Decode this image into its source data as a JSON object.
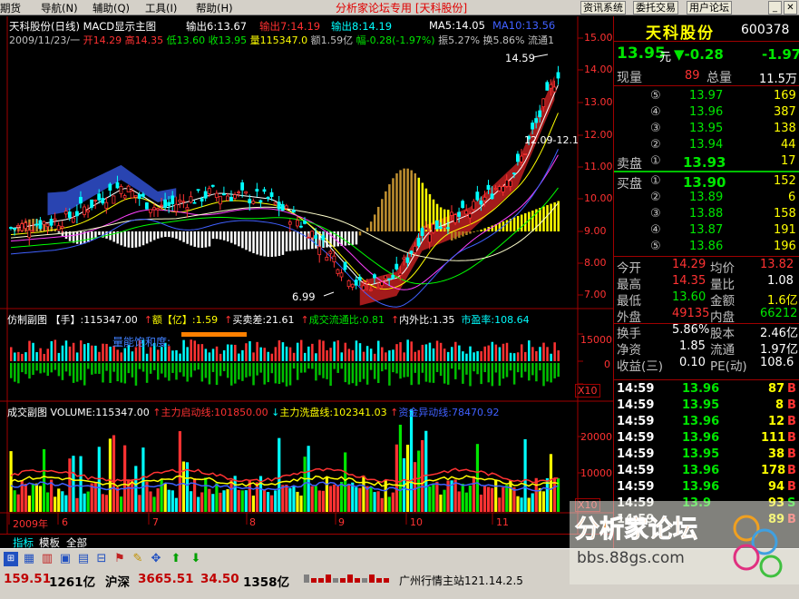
{
  "menu": {
    "items": [
      "期货",
      "导航(N)",
      "辅助(Q)",
      "工具(I)",
      "帮助(H)"
    ],
    "center_title": "分析家论坛专用 [天科股份]",
    "buttons": [
      "资讯系统",
      "委托交易",
      "用户论坛"
    ]
  },
  "chart_header": {
    "line1_name": "天科股份(日线) MACD显示主图",
    "out1": "输出6:13.67",
    "out2": "输出7:14.19",
    "out3": "输出8:14.19",
    "ma5": "MA5:14.05",
    "ma10": "MA10:13.56",
    "line2_date": "2009/11/23/一",
    "open": "开14.29",
    "high": "高14.35",
    "low": "低13.60",
    "close": "收13.95",
    "volume": "量115347.0",
    "amount": "额1.59亿",
    "change": "幅-0.28(-1.97%)",
    "amplitude": "振5.27%",
    "turnover": "换5.86%",
    "float": "流通1"
  },
  "main_chart": {
    "price_ticks": [
      "15.00",
      "14.00",
      "13.00",
      "12.00",
      "11.00",
      "10.00",
      "9.00",
      "8.00",
      "7.00"
    ],
    "high_label": "14.59",
    "low_label": "6.99",
    "range_label": "12.09-12.1"
  },
  "sub1": {
    "header": [
      "仿制副图 【手】:115347.00",
      "额【亿】:1.59",
      "买卖差:21.61",
      "成交流通比:0.81",
      "内外比:1.35",
      "市盈率:108.64"
    ],
    "label": "量能饱和度:",
    "ticks": [
      "15000",
      "0",
      "-15000"
    ],
    "scale": "X10"
  },
  "sub2": {
    "header": [
      "成交副图 VOLUME:115347.00",
      "主力启动线:101850.00",
      "主力洗盘线:102341.03",
      "资金异动线:78470.92"
    ],
    "ticks": [
      "20000",
      "10000"
    ],
    "scale": "X10"
  },
  "x_axis": {
    "labels": [
      "2009年",
      "6",
      "7",
      "8",
      "9",
      "10",
      "11"
    ]
  },
  "tabs": [
    "指标",
    "模板",
    "全部"
  ],
  "stock": {
    "name": "天科股份",
    "code": "600378",
    "price": "13.95",
    "unit": "元",
    "change": "▼-0.28",
    "change_pct": "-1.97",
    "now_vol_label": "现量",
    "now_vol": "89",
    "total_vol_label": "总量",
    "total_vol": "11.5万"
  },
  "asks": [
    {
      "level": "⑤",
      "price": "13.97",
      "vol": "169"
    },
    {
      "level": "④",
      "price": "13.96",
      "vol": "387"
    },
    {
      "level": "③",
      "price": "13.95",
      "vol": "138"
    },
    {
      "level": "②",
      "price": "13.94",
      "vol": "44"
    },
    {
      "label": "卖盘",
      "level": "①",
      "price": "13.93",
      "vol": "17"
    }
  ],
  "bids": [
    {
      "label": "买盘",
      "level": "①",
      "price": "13.90",
      "vol": "152"
    },
    {
      "level": "②",
      "price": "13.89",
      "vol": "6"
    },
    {
      "level": "③",
      "price": "13.88",
      "vol": "158"
    },
    {
      "level": "④",
      "price": "13.87",
      "vol": "191"
    },
    {
      "level": "⑤",
      "price": "13.86",
      "vol": "196"
    }
  ],
  "stats": [
    {
      "l1": "今开",
      "v1": "14.29",
      "l2": "均价",
      "v2": "13.82"
    },
    {
      "l1": "最高",
      "v1": "14.35",
      "l2": "量比",
      "v2": "1.08"
    },
    {
      "l1": "最低",
      "v1": "13.60",
      "l2": "金额",
      "v2": "1.6亿"
    },
    {
      "l1": "外盘",
      "v1": "49135",
      "l2": "内盘",
      "v2": "66212"
    },
    {
      "l1": "换手",
      "v1": "5.86%",
      "l2": "股本",
      "v2": "2.46亿"
    },
    {
      "l1": "净资",
      "v1": "1.85",
      "l2": "流通",
      "v2": "1.97亿"
    },
    {
      "l1": "收益(三)",
      "v1": "0.10",
      "l2": "PE(动)",
      "v2": "108.6"
    }
  ],
  "ticks": [
    {
      "time": "14:59",
      "price": "13.96",
      "vol": "87",
      "side": "B"
    },
    {
      "time": "14:59",
      "price": "13.95",
      "vol": "8",
      "side": "B"
    },
    {
      "time": "14:59",
      "price": "13.96",
      "vol": "12",
      "side": "B"
    },
    {
      "time": "14:59",
      "price": "13.96",
      "vol": "111",
      "side": "B"
    },
    {
      "time": "14:59",
      "price": "13.95",
      "vol": "38",
      "side": "B"
    },
    {
      "time": "14:59",
      "price": "13.96",
      "vol": "178",
      "side": "B"
    },
    {
      "time": "14:59",
      "price": "13.96",
      "vol": "94",
      "side": "B"
    },
    {
      "time": "14:59",
      "price": "13.9",
      "vol": "93",
      "side": "S"
    },
    {
      "time": "14:59",
      "price": "",
      "vol": "89",
      "side": "B"
    }
  ],
  "statusbar": {
    "v1": "159.51",
    "v2": "1261亿",
    "label": "沪深",
    "v3": "3665.51",
    "v4": "34.50",
    "v5": "1358亿",
    "station": "广州行情主站121.14.2.5"
  },
  "watermark": {
    "title": "分析家论坛",
    "url": "bbs.88gs.com"
  },
  "colors": {
    "up": "#ff3232",
    "down": "#00e600",
    "yellow": "#ffff00",
    "cyan": "#00ffff",
    "blue": "#4060ff",
    "grid": "#a00000"
  }
}
